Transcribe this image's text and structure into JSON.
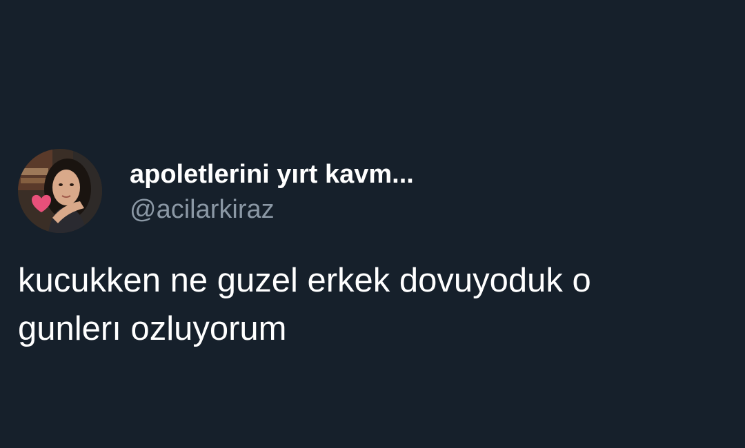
{
  "tweet": {
    "author": {
      "display_name": "apoletlerini yırt kavm...",
      "handle": "@acilarkiraz",
      "avatar_icon": "profile-photo",
      "avatar_badge_icon": "heart-icon"
    },
    "text_line_1": "kucukken ne guzel erkek dovuyoduk o",
    "text_line_2": "gunlerı ozluyorum"
  },
  "colors": {
    "background": "#16202b",
    "text_primary": "#ffffff",
    "text_secondary": "#8b98a5",
    "heart": "#e8507a"
  }
}
